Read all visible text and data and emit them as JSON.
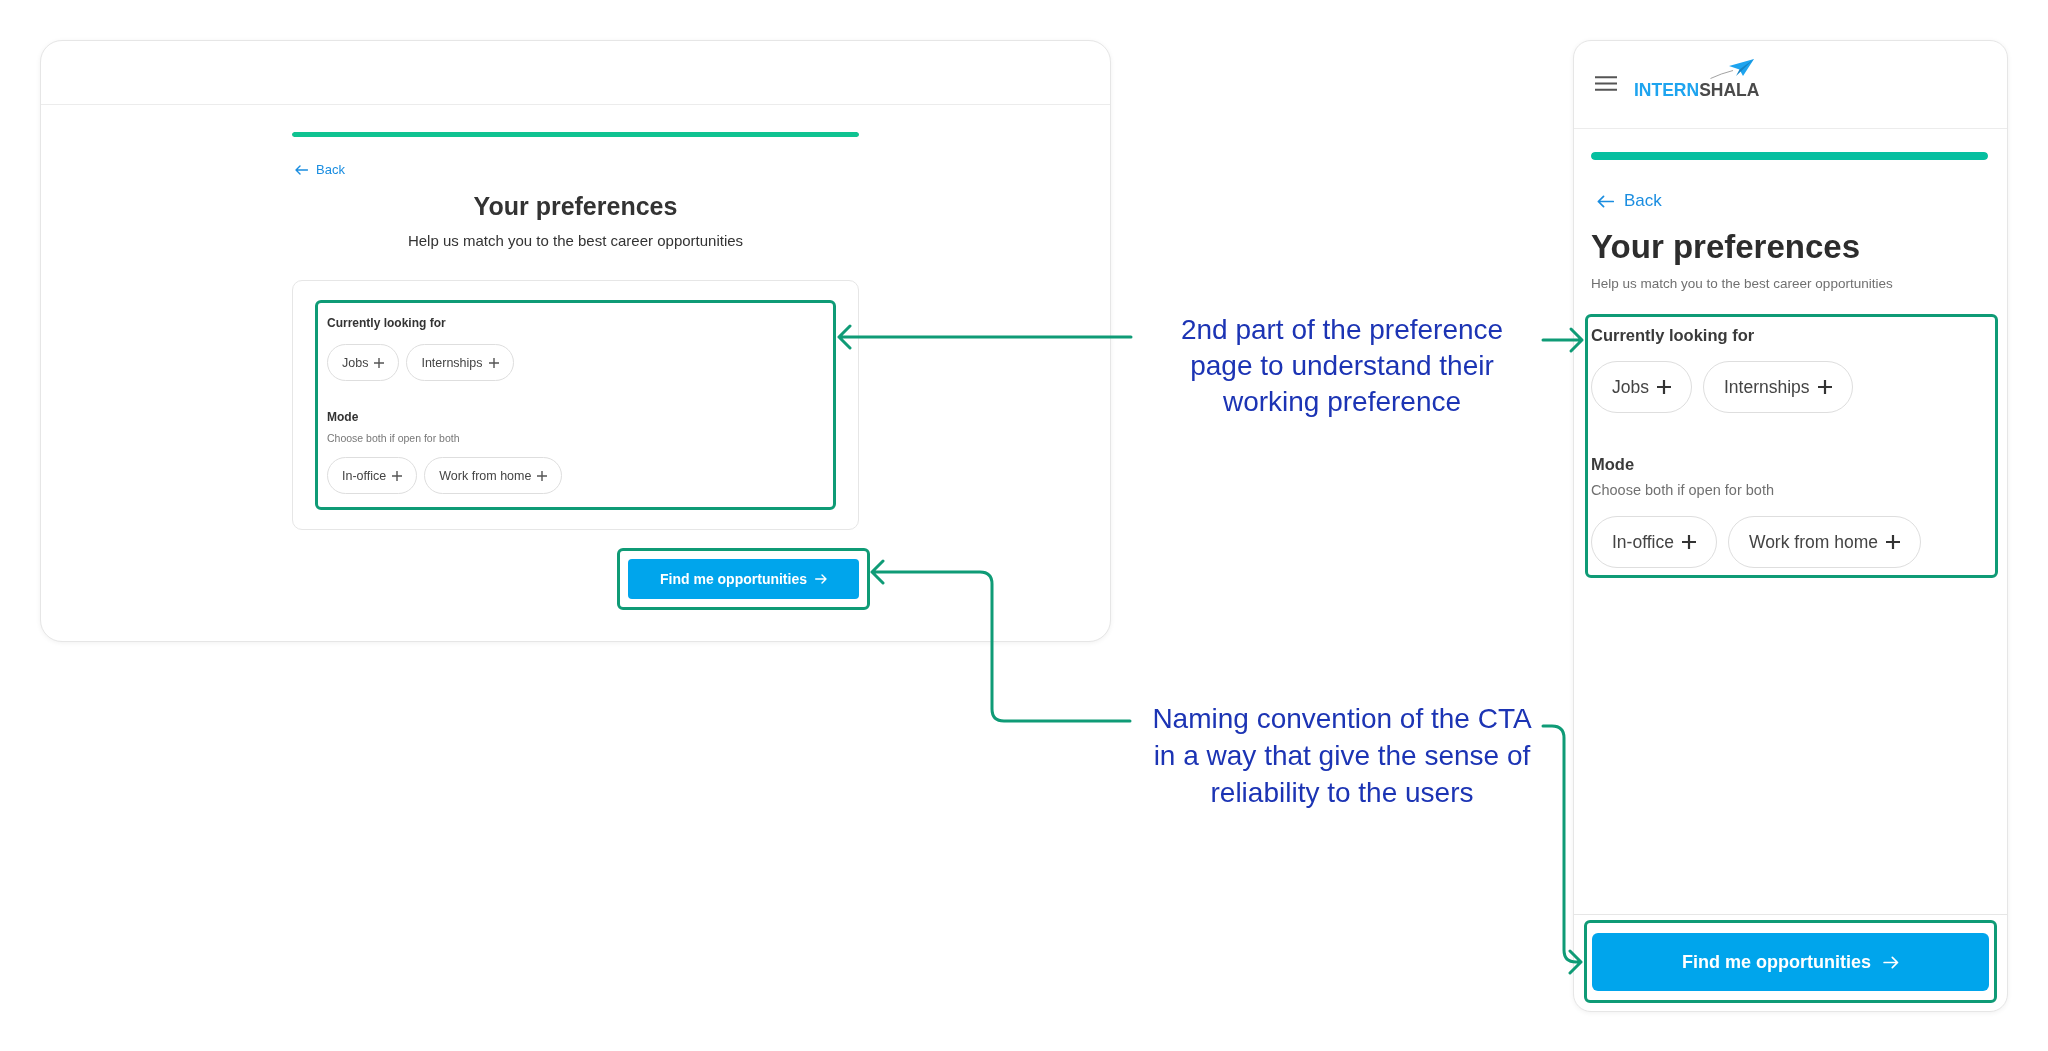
{
  "desktop": {
    "progress": {
      "level": 1
    },
    "back_link": "Back",
    "title": "Your preferences",
    "subtitle": "Help us match you to the best career opportunities",
    "sections": [
      {
        "heading": "Currently looking for",
        "options": [
          {
            "label": "Jobs",
            "selected": false
          },
          {
            "label": "Internships",
            "selected": false
          }
        ]
      },
      {
        "heading": "Mode",
        "hint": "Choose both if open for both",
        "options": [
          {
            "label": "In-office",
            "selected": false
          },
          {
            "label": "Work from home",
            "selected": false
          }
        ]
      }
    ],
    "cta": "Find me opportunities"
  },
  "annotations": [
    {
      "text": "2nd part of the preference\npage to understand their\nworking preference"
    },
    {
      "text": "Naming convention of the CTA\nin a way that give the sense of\nreliability to the users"
    }
  ],
  "mobile": {
    "logo": {
      "prefix": "INTERN",
      "suffix": "SHALA"
    },
    "progress": {
      "level": 1
    },
    "back_link": "Back",
    "title": "Your preferences",
    "subtitle": "Help us match you to the best career opportunities",
    "sections": [
      {
        "heading": "Currently looking for",
        "options": [
          {
            "label": "Jobs",
            "selected": false
          },
          {
            "label": "Internships",
            "selected": false
          }
        ]
      },
      {
        "heading": "Mode",
        "hint": "Choose both if open for both",
        "options": [
          {
            "label": "In-office",
            "selected": false
          },
          {
            "label": "Work from home",
            "selected": false
          }
        ]
      }
    ],
    "cta": "Find me opportunities"
  }
}
